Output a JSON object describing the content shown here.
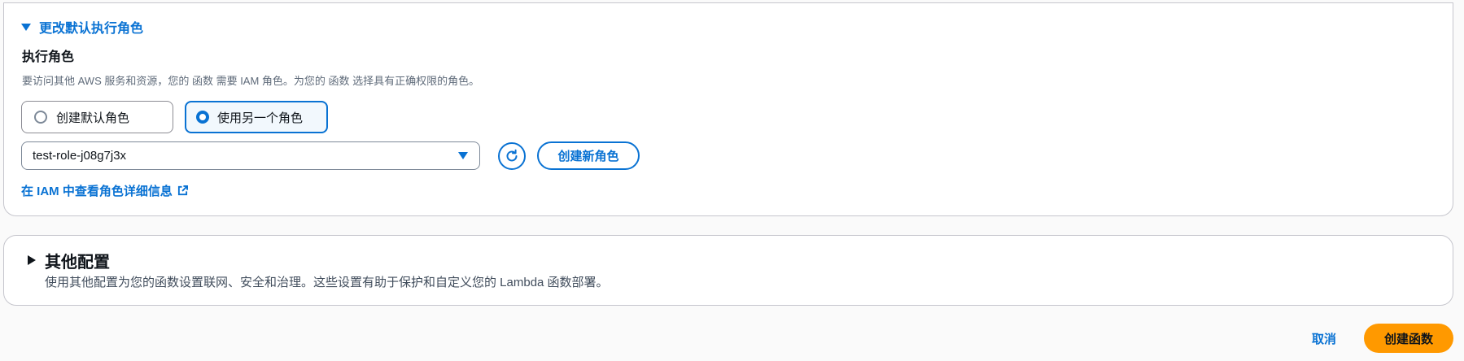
{
  "role_section": {
    "toggle_label": "更改默认执行角色",
    "expanded": true,
    "field_label": "执行角色",
    "description": "要访问其他 AWS 服务和资源，您的 函数 需要 IAM 角色。为您的 函数 选择具有正确权限的角色。",
    "options": [
      {
        "label": "创建默认角色",
        "selected": false
      },
      {
        "label": "使用另一个角色",
        "selected": true
      }
    ],
    "selected_role": "test-role-j08g7j3x",
    "refresh_icon": "refresh-icon",
    "create_role_label": "创建新角色",
    "iam_link_label": "在 IAM 中查看角色详细信息",
    "iam_link_icon": "external-link-icon"
  },
  "additional_config": {
    "title": "其他配置",
    "expanded": false,
    "description": "使用其他配置为您的函数设置联网、安全和治理。这些设置有助于保护和自定义您的 Lambda 函数部署。"
  },
  "footer": {
    "cancel_label": "取消",
    "submit_label": "创建函数"
  },
  "colors": {
    "link_blue": "#0972d3",
    "primary_orange": "#ff9900",
    "text_dark": "#0f141a",
    "border_grey": "#c6c6cd"
  }
}
